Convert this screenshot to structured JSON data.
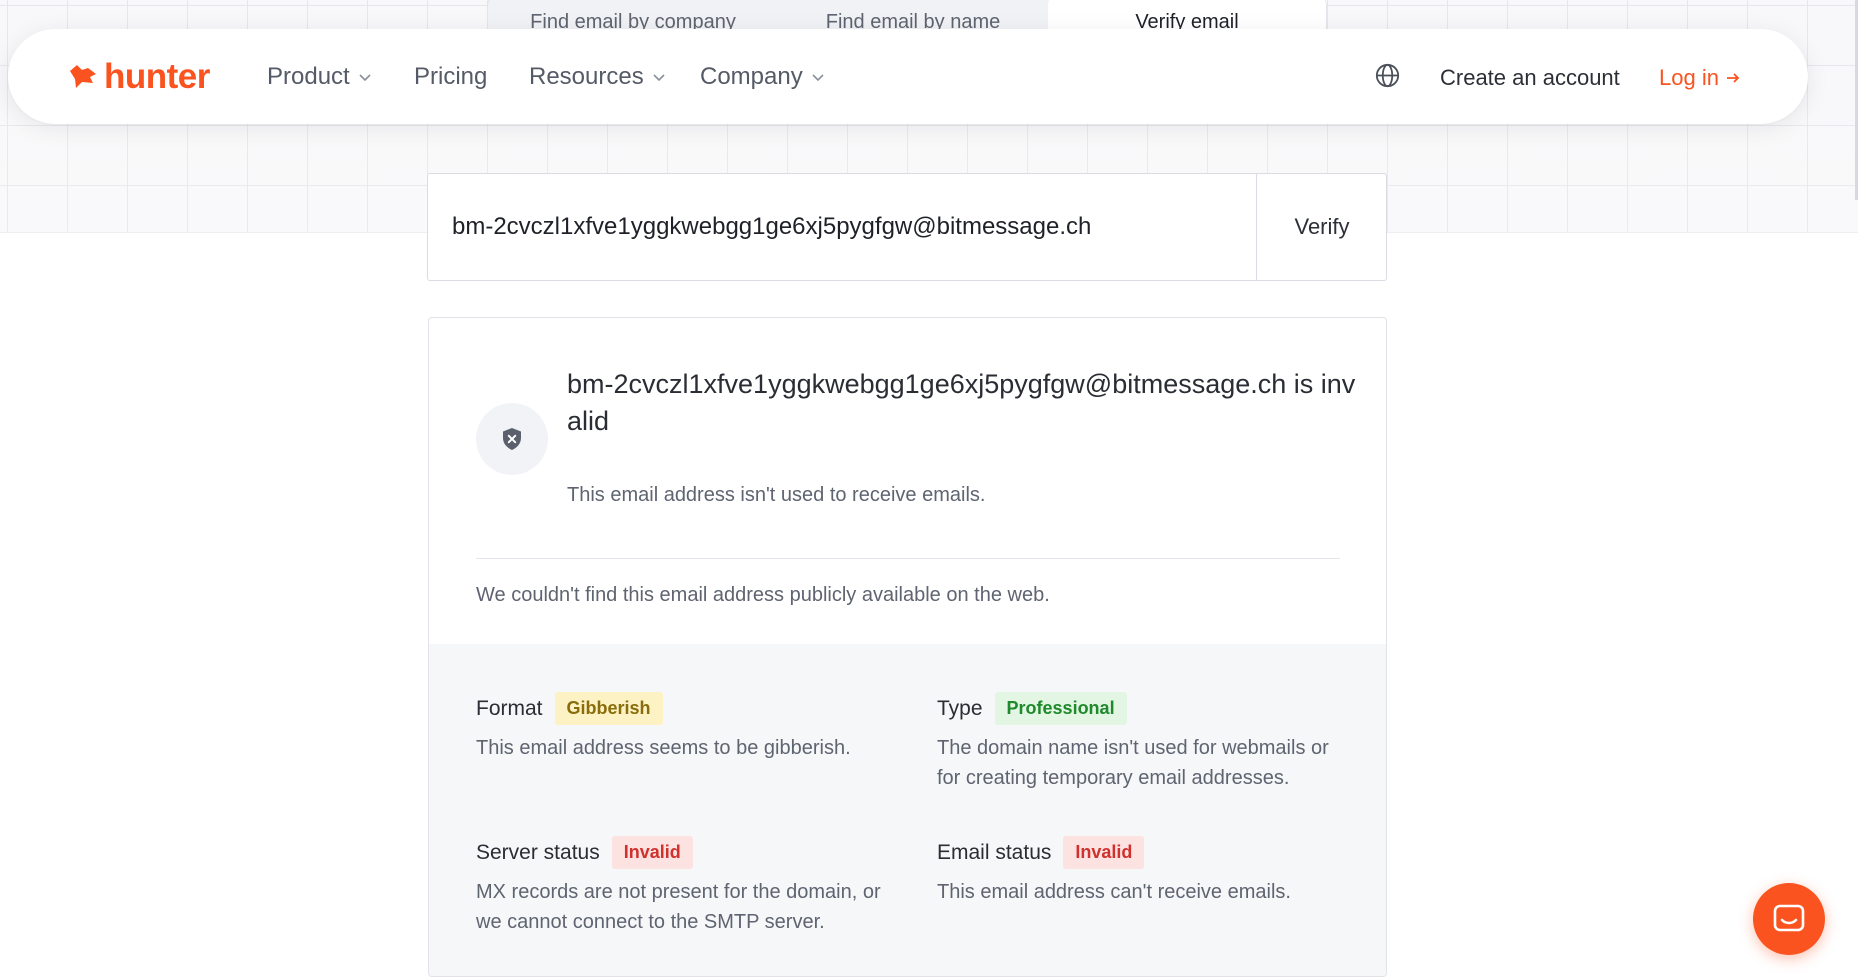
{
  "tabs": [
    "Find email by company",
    "Find email by name",
    "Verify email"
  ],
  "header": {
    "logo_text": "hunter",
    "nav": [
      "Product",
      "Pricing",
      "Resources",
      "Company"
    ],
    "create_account": "Create an account",
    "login": "Log in"
  },
  "search": {
    "value": "bm-2cvczl1xfve1yggkwebgg1ge6xj5pygfgw@bitmessage.ch",
    "button": "Verify"
  },
  "result": {
    "title": "bm-2cvczl1xfve1yggkwebgg1ge6xj5pygfgw@bitmessage.ch is invalid",
    "subtitle": "This email address isn't used to receive emails.",
    "web_note": "We couldn't find this email address publicly available on the web.",
    "fields": [
      {
        "label": "Format",
        "badge": "Gibberish",
        "badge_color": "yellow",
        "desc": "This email address seems to be gibberish."
      },
      {
        "label": "Type",
        "badge": "Professional",
        "badge_color": "green",
        "desc": "The domain name isn't used for webmails or for creating temporary email addresses."
      },
      {
        "label": "Server status",
        "badge": "Invalid",
        "badge_color": "red",
        "desc": "MX records are not present for the domain, or we cannot connect to the SMTP server."
      },
      {
        "label": "Email status",
        "badge": "Invalid",
        "badge_color": "red",
        "desc": "This email address can't receive emails."
      }
    ]
  },
  "colors": {
    "accent": "#fa5320"
  },
  "icons": [
    "logo-fox-icon",
    "chevron-down-icon",
    "globe-icon",
    "arrow-right-icon",
    "shield-x-icon",
    "chat-icon"
  ]
}
